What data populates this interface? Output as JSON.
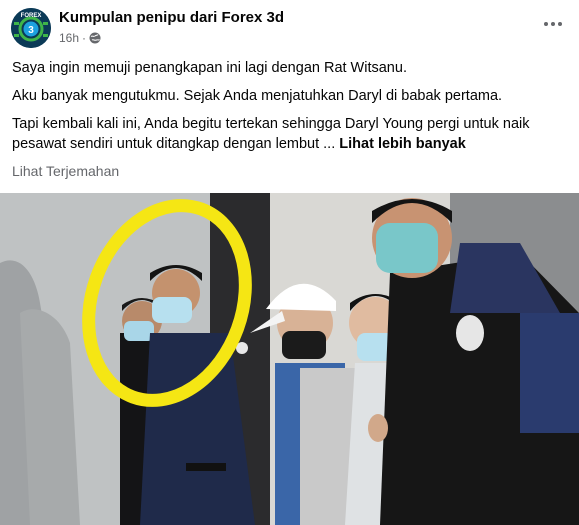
{
  "post": {
    "author": "Kumpulan penipu dari Forex 3d",
    "timestamp": "16h",
    "avatar": {
      "icon": "forex-logo-icon",
      "lettering": "FOREX 3D"
    },
    "paragraphs": [
      "Saya ingin memuji penangkapan ini lagi dengan Rat Witsanu.",
      "Aku banyak mengutukmu. Sejak Anda menjatuhkan Daryl di babak pertama.",
      "Tapi kembali kali ini, Anda begitu tertekan sehingga Daryl Young pergi untuk naik pesawat sendiri untuk ditangkap dengan lembut ..."
    ],
    "see_more": "Lihat lebih banyak",
    "see_translation": "Lihat Terjemahan",
    "photo": {
      "icon": "arrest-photo-image",
      "annotation_color": "#f5e614"
    }
  }
}
